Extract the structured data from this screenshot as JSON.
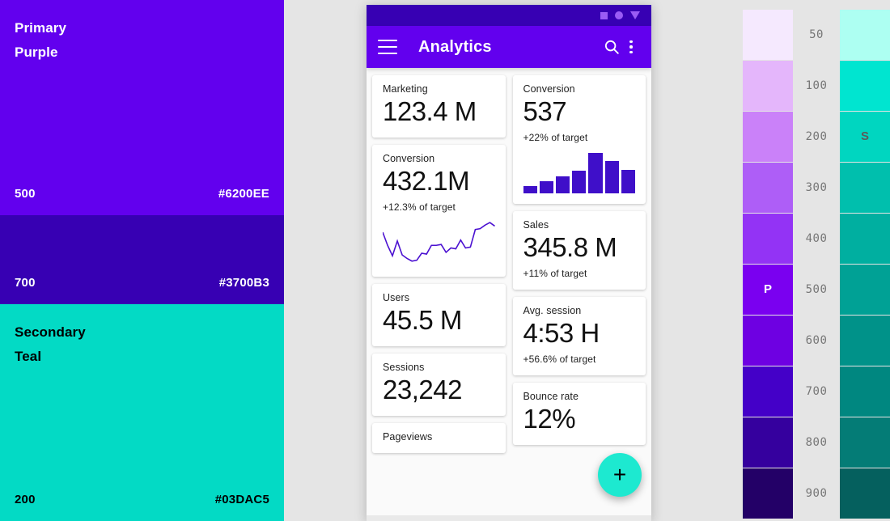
{
  "brand": {
    "primary": {
      "title_line1": "Primary",
      "title_line2": "Purple",
      "tone": "500",
      "hex": "#6200EE"
    },
    "primary_dark": {
      "tone": "700",
      "hex": "#3700B3"
    },
    "secondary": {
      "title_line1": "Secondary",
      "title_line2": "Teal",
      "tone": "200",
      "hex": "#03DAC5"
    }
  },
  "phone": {
    "status_bar": {
      "icons": [
        "square-icon",
        "circle-icon",
        "triangle-down-icon"
      ]
    },
    "app_bar": {
      "menu_icon": "hamburger-menu-icon",
      "title": "Analytics",
      "search_icon": "search-icon",
      "overflow_icon": "more-vertical-icon"
    },
    "fab": {
      "label": "+",
      "icon": "plus-icon",
      "color": "#1DE9D0"
    },
    "left_column": [
      {
        "label": "Marketing",
        "value": "123.4 M",
        "sub": "",
        "viz": "none"
      },
      {
        "label": "Conversion",
        "value": "432.1M",
        "sub": "+12.3% of target",
        "viz": "line"
      },
      {
        "label": "Users",
        "value": "45.5 M",
        "sub": "",
        "viz": "none"
      },
      {
        "label": "Sessions",
        "value": "23,242",
        "sub": "",
        "viz": "none"
      },
      {
        "label": "Pageviews",
        "value": "",
        "sub": "",
        "viz": "none"
      }
    ],
    "right_column": [
      {
        "label": "Conversion",
        "value": "537",
        "sub": "+22% of target",
        "viz": "bar"
      },
      {
        "label": "Sales",
        "value": "345.8 M",
        "sub": "+11% of target",
        "viz": "none"
      },
      {
        "label": "Avg. session",
        "value": "4:53 H",
        "sub": "+56.6% of target",
        "viz": "none"
      },
      {
        "label": "Bounce rate",
        "value": "12%",
        "sub": "",
        "viz": "none"
      }
    ]
  },
  "chart_data": [
    {
      "type": "line",
      "title": "Conversion sparkline",
      "card": "Conversion",
      "x": [
        0,
        1,
        2,
        3,
        4,
        5,
        6,
        7,
        8,
        9,
        10,
        11,
        12,
        13,
        14,
        15,
        16,
        17,
        18,
        19,
        20,
        21,
        22,
        23
      ],
      "values": [
        74,
        44,
        20,
        54,
        22,
        14,
        8,
        10,
        26,
        24,
        44,
        44,
        46,
        28,
        38,
        36,
        56,
        38,
        40,
        80,
        82,
        90,
        96,
        88
      ],
      "ylim": [
        0,
        100
      ],
      "grid": false,
      "color": "#4B11D1"
    },
    {
      "type": "bar",
      "title": "Conversion bars",
      "card": "Conversion",
      "categories": [
        "1",
        "2",
        "3",
        "4",
        "5",
        "6",
        "7"
      ],
      "values": [
        18,
        30,
        42,
        55,
        100,
        80,
        58
      ],
      "ylim": [
        0,
        100
      ],
      "grid": false,
      "color": "#3F0FC9"
    }
  ],
  "palette": {
    "tones": [
      "50",
      "100",
      "200",
      "300",
      "400",
      "500",
      "600",
      "700",
      "800",
      "900"
    ],
    "purple": [
      "#F5E9FE",
      "#E4B6FB",
      "#CA81F9",
      "#AE5EF7",
      "#9333F5",
      "#7A00F0",
      "#6E00E2",
      "#4400C8",
      "#35009E",
      "#230067"
    ],
    "teal": [
      "#ADFFF2",
      "#00E5D0",
      "#00D6C0",
      "#00BFAD",
      "#00AFA0",
      "#00A195",
      "#009289",
      "#008780",
      "#047C76",
      "#05605E"
    ],
    "badges": [
      {
        "tone": "500",
        "column": "purple",
        "letter": "P",
        "text_color": "#FFFFFF"
      },
      {
        "tone": "700",
        "column": "purple",
        "letter": "",
        "text_color": "#FFFFFF"
      },
      {
        "tone": "200",
        "column": "teal",
        "letter": "S",
        "text_color": "#5a5a5a"
      }
    ]
  }
}
